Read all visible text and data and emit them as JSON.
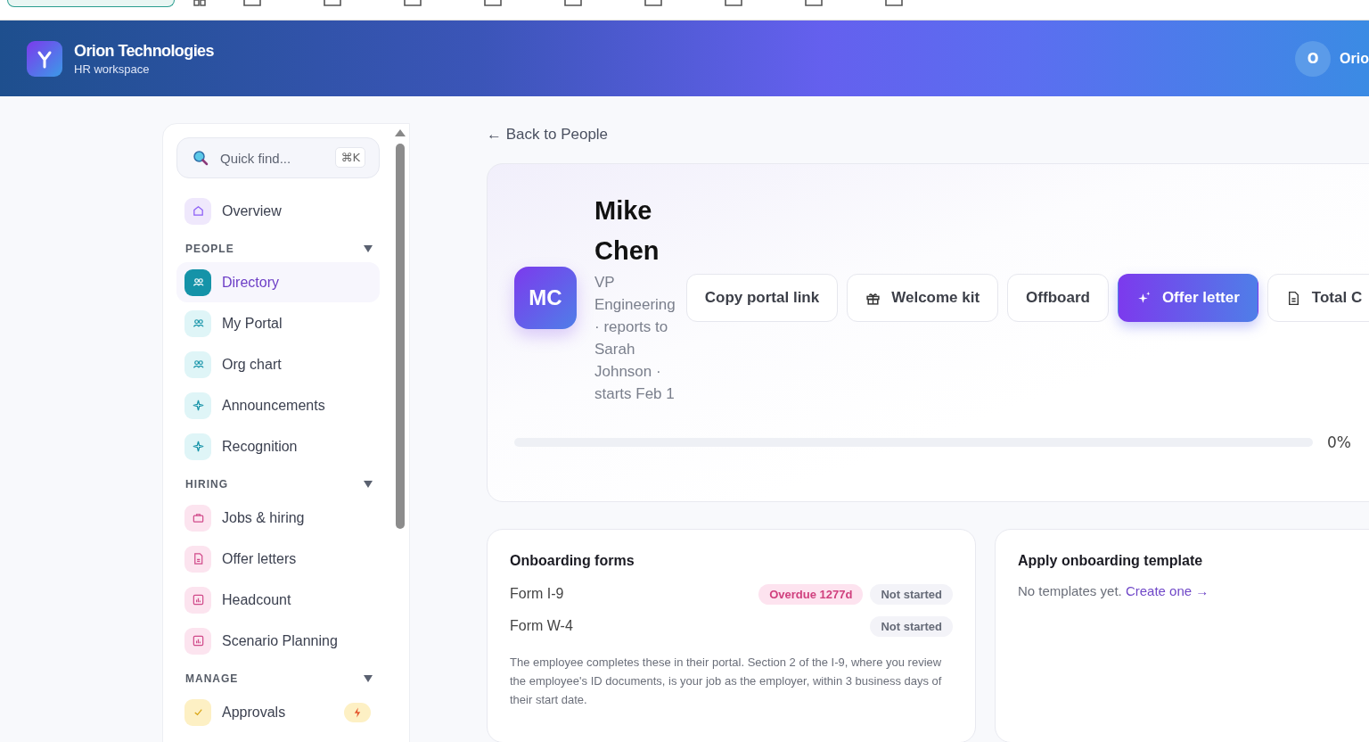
{
  "header": {
    "company": "Orion Technologies",
    "subtitle": "HR workspace",
    "avatar": "O",
    "user": "Orio"
  },
  "sidebar": {
    "search": {
      "placeholder": "Quick find...",
      "shortcut": "⌘K"
    },
    "top_items": [
      {
        "label": "Overview",
        "kind": "home",
        "selected": false
      }
    ],
    "sections": [
      {
        "title": "PEOPLE",
        "expanded": true,
        "items": [
          {
            "label": "Directory",
            "kind": "people",
            "selected": true
          },
          {
            "label": "My Portal",
            "kind": "people",
            "selected": false
          },
          {
            "label": "Org chart",
            "kind": "people",
            "selected": false
          },
          {
            "label": "Announcements",
            "kind": "sparkle",
            "selected": false
          },
          {
            "label": "Recognition",
            "kind": "sparkle",
            "selected": false
          }
        ]
      },
      {
        "title": "HIRING",
        "expanded": true,
        "items": [
          {
            "label": "Jobs & hiring",
            "kind": "briefcase",
            "selected": false
          },
          {
            "label": "Offer letters",
            "kind": "document",
            "selected": false
          },
          {
            "label": "Headcount",
            "kind": "chart",
            "selected": false
          },
          {
            "label": "Scenario Planning",
            "kind": "chart",
            "selected": false
          }
        ]
      },
      {
        "title": "MANAGE",
        "expanded": true,
        "items": [
          {
            "label": "Approvals",
            "kind": "check",
            "selected": false,
            "alert": true
          }
        ]
      }
    ]
  },
  "back_link": "← Back to People",
  "profile": {
    "initials": "MC",
    "name": "Mike Chen",
    "subtitle": "VP Engineering · reports to Sarah Johnson · starts Feb 1",
    "actions": [
      {
        "label": "Copy portal link",
        "kind": "plain"
      },
      {
        "label": "Welcome kit",
        "kind": "gift"
      },
      {
        "label": "Offboard",
        "kind": "plain"
      },
      {
        "label": "Offer letter",
        "kind": "primary"
      },
      {
        "label": "Total C",
        "kind": "document"
      }
    ],
    "progress": {
      "level": 0,
      "reading": "0%"
    }
  },
  "onboarding_forms": {
    "title": "Onboarding forms",
    "rows": [
      {
        "name": "Form I-9",
        "overdue": "Overdue 1277d",
        "status": "Not started"
      },
      {
        "name": "Form W-4",
        "status": "Not started"
      }
    ],
    "note": "The employee completes these in their portal. Section 2 of the I-9, where you review the employee's ID documents, is your job as the employer, within 3 business days of their start date."
  },
  "template": {
    "title": "Apply onboarding template",
    "text": "No templates yet.",
    "link": "Create one →"
  }
}
